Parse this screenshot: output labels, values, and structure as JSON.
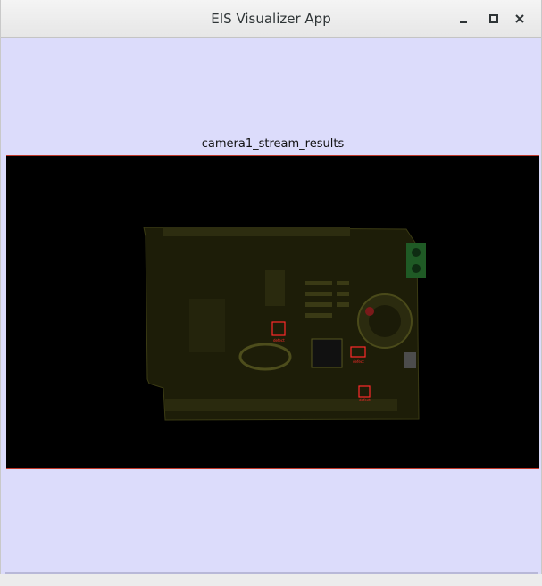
{
  "window": {
    "title": "EIS Visualizer App",
    "buttons": {
      "minimize": "minimize-icon",
      "maximize": "maximize-icon",
      "close": "close-icon"
    }
  },
  "stream": {
    "label": "camera1_stream_results",
    "detections": [
      {
        "label": "defect"
      },
      {
        "label": "defect"
      },
      {
        "label": "defect"
      }
    ]
  },
  "colors": {
    "background": "#dcdcfb",
    "stream_bg": "#000000",
    "frame_border": "#c0392b",
    "detection_box": "#ff2a2a",
    "board": "#2a2a10"
  }
}
